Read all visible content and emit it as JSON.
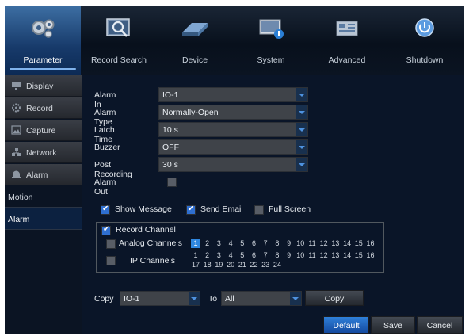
{
  "tabs": [
    {
      "label": "Parameter",
      "icon": "gears-icon",
      "active": true
    },
    {
      "label": "Record Search",
      "icon": "magnifier-icon"
    },
    {
      "label": "Device",
      "icon": "hard-drive-icon"
    },
    {
      "label": "System",
      "icon": "monitor-info-icon"
    },
    {
      "label": "Advanced",
      "icon": "settings-panel-icon"
    },
    {
      "label": "Shutdown",
      "icon": "power-icon"
    }
  ],
  "sidebar": {
    "items": [
      {
        "label": "Display",
        "icon": "monitor-icon"
      },
      {
        "label": "Record",
        "icon": "record-gear-icon"
      },
      {
        "label": "Capture",
        "icon": "capture-icon"
      },
      {
        "label": "Network",
        "icon": "network-icon"
      },
      {
        "label": "Alarm",
        "icon": "alarm-icon"
      }
    ],
    "subitems": [
      {
        "label": "Motion"
      },
      {
        "label": "Alarm",
        "active": true
      }
    ]
  },
  "form": {
    "alarm_in": {
      "label": "Alarm In",
      "value": "IO-1"
    },
    "alarm_type": {
      "label": "Alarm Type",
      "value": "Normally-Open"
    },
    "latch_time": {
      "label": "Latch Time",
      "value": "10 s"
    },
    "buzzer": {
      "label": "Buzzer",
      "value": "OFF"
    },
    "post_recording": {
      "label": "Post Recording",
      "value": "30 s"
    },
    "alarm_out": {
      "label": "Alarm Out",
      "checked": false
    }
  },
  "notify": {
    "show_message": {
      "label": "Show Message",
      "checked": true
    },
    "send_email": {
      "label": "Send Email",
      "checked": true
    },
    "full_screen": {
      "label": "Full Screen",
      "checked": false
    }
  },
  "record_channel": {
    "label": "Record Channel",
    "checked": true,
    "analog": {
      "label": "Analog Channels",
      "checked": false,
      "channels": [
        "1",
        "2",
        "3",
        "4",
        "5",
        "6",
        "7",
        "8",
        "9",
        "10",
        "11",
        "12",
        "13",
        "14",
        "15",
        "16"
      ],
      "selected": [
        "1"
      ]
    },
    "ip": {
      "label": "IP Channels",
      "checked": false,
      "channels": [
        "1",
        "2",
        "3",
        "4",
        "5",
        "6",
        "7",
        "8",
        "9",
        "10",
        "11",
        "12",
        "13",
        "14",
        "15",
        "16",
        "17",
        "18",
        "19",
        "20",
        "21",
        "22",
        "23",
        "24"
      ]
    }
  },
  "copy": {
    "label": "Copy",
    "from": "IO-1",
    "to_label": "To",
    "to": "All",
    "button": "Copy"
  },
  "buttons": {
    "default": "Default",
    "save": "Save",
    "cancel": "Cancel"
  },
  "colors": {
    "accent": "#2f7fd8",
    "active_tab": "#2a5c92",
    "background": "#0a1528"
  }
}
